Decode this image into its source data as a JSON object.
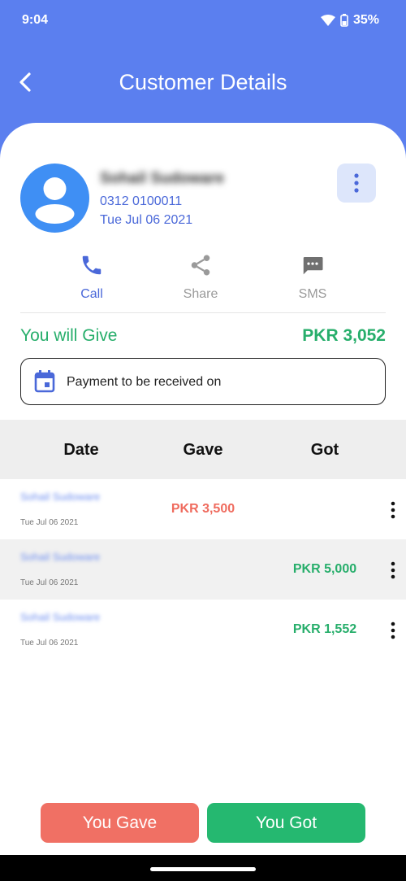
{
  "status_bar": {
    "time": "9:04",
    "battery": "35%"
  },
  "header": {
    "title": "Customer Details"
  },
  "customer": {
    "name": "Sohail Sudoware",
    "phone": "0312 0100011",
    "date": "Tue Jul 06 2021"
  },
  "actions": [
    {
      "label": "Call",
      "icon": "phone-icon",
      "color": "#4a68d9"
    },
    {
      "label": "Share",
      "icon": "share-icon",
      "color": "#9a9a9a"
    },
    {
      "label": "SMS",
      "icon": "sms-icon",
      "color": "#9a9a9a"
    }
  ],
  "balance": {
    "label": "You will Give",
    "amount": "PKR 3,052"
  },
  "payment": {
    "label": "Payment to be received on"
  },
  "table": {
    "headers": {
      "date": "Date",
      "gave": "Gave",
      "got": "Got"
    },
    "rows": [
      {
        "name": "Sohail Sudoware",
        "date": "Tue Jul 06 2021",
        "gave": "PKR 3,500",
        "got": ""
      },
      {
        "name": "Sohail Sudoware",
        "date": "Tue Jul 06 2021",
        "gave": "",
        "got": "PKR 5,000"
      },
      {
        "name": "Sohail Sudoware",
        "date": "Tue Jul 06 2021",
        "gave": "",
        "got": "PKR 1,552"
      }
    ]
  },
  "buttons": {
    "gave": "You Gave",
    "got": "You Got"
  },
  "colors": {
    "primary": "#5b7fef",
    "gave": "#f07064",
    "got": "#25b870",
    "positive_text": "#27ae6b",
    "negative_text": "#ef6b5e"
  }
}
